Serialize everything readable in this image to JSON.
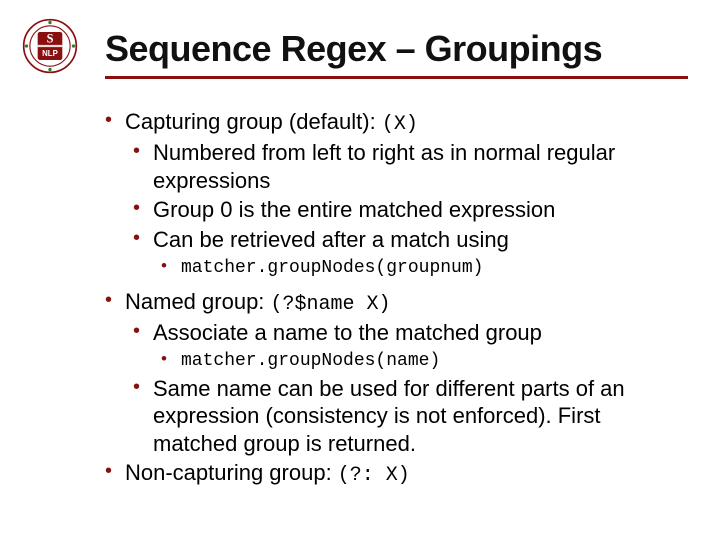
{
  "slide": {
    "title": "Sequence Regex – Groupings",
    "logo_letters": {
      "top": "S",
      "bottom": "NLP"
    },
    "items": {
      "capturing": {
        "label": "Capturing group (default): ",
        "code": "(X)",
        "children": {
          "numbered": "Numbered from left to right as in normal regular expressions",
          "group0": "Group 0 is the entire matched expression",
          "retrieved": "Can be retrieved after a match using",
          "retrieved_code": "matcher.groupNodes(groupnum)"
        }
      },
      "named": {
        "label": "Named group: ",
        "code": "(?$name X)",
        "children": {
          "assoc": "Associate a name to the matched group",
          "assoc_code": "matcher.groupNodes(name)",
          "same": "Same name can be used for different parts of an expression (consistency is not enforced). First matched group is returned."
        }
      },
      "noncap": {
        "label": "Non-capturing group: ",
        "code": "(?: X)"
      }
    }
  }
}
